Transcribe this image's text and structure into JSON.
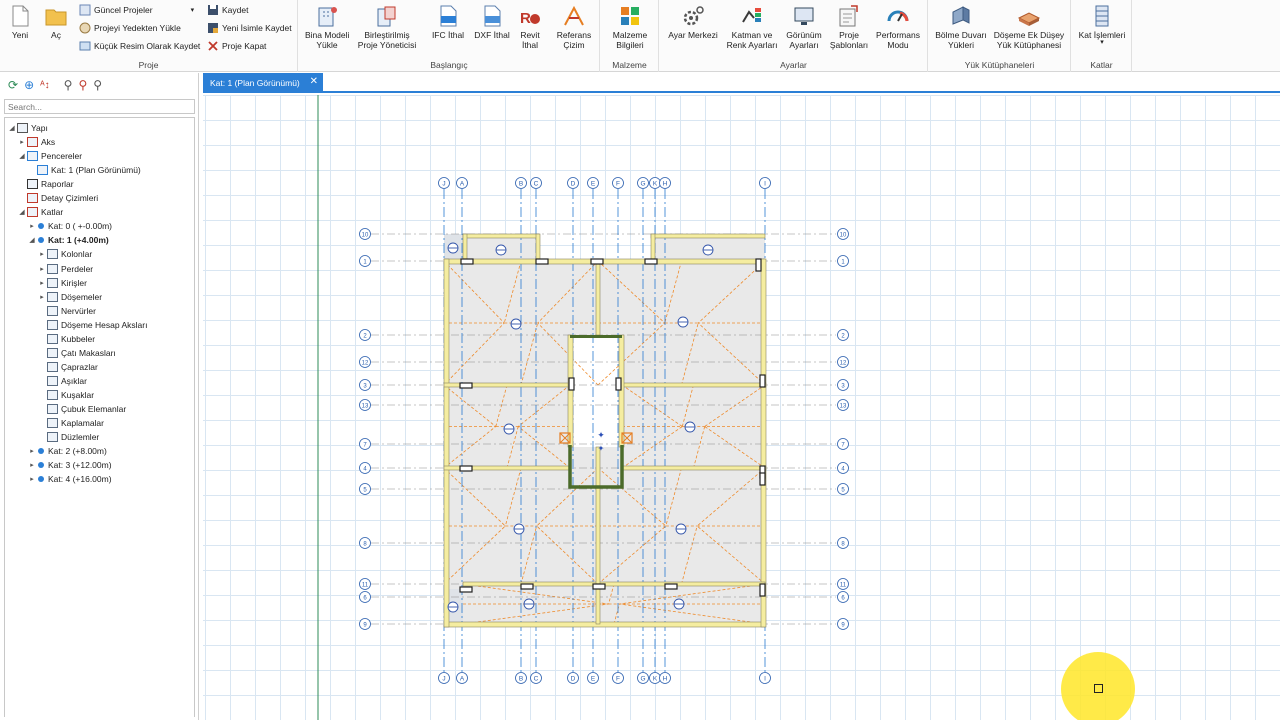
{
  "ribbon": {
    "yeni": "Yeni",
    "ac": "Aç",
    "guncel_projeler": "Güncel Projeler",
    "projeyi_yedekten_yukle": "Projeyi Yedekten Yükle",
    "kucuk_resim": "Küçük Resim Olarak Kaydet",
    "kaydet": "Kaydet",
    "yeni_isimle": "Yeni İsimle Kaydet",
    "proje_kapat": "Proje Kapat",
    "group_proje": "Proje",
    "bina_modeli": "Bina Modeli\nYükle",
    "birlestirilmis": "Birleştirilmiş\nProje Yöneticisi",
    "ifc": "IFC İthal",
    "dxf": "DXF İthal",
    "revit": "Revit\nİthal",
    "referans": "Referans\nÇizim",
    "group_baslangic": "Başlangıç",
    "malzeme_bilgileri": "Malzeme\nBilgileri",
    "group_malzeme": "Malzeme",
    "ayar_merkezi": "Ayar Merkezi",
    "katman": "Katman ve\nRenk Ayarları",
    "gorunum": "Görünüm\nAyarları",
    "proje_sablonlari": "Proje\nŞablonları",
    "performans": "Performans\nModu",
    "group_ayarlar": "Ayarlar",
    "bolme_duvari": "Bölme Duvarı\nYükleri",
    "doseme_ek": "Döşeme Ek Düşey\nYük Kütüphanesi",
    "group_yuk": "Yük Kütüphaneleri",
    "kat_islemleri": "Kat İşlemleri",
    "group_katlar": "Katlar"
  },
  "search": {
    "placeholder": "Search..."
  },
  "tree": [
    {
      "label": "Yapı",
      "level": 0,
      "arrow": "open",
      "icon": "structure-icon",
      "bold": false
    },
    {
      "label": "Aks",
      "level": 1,
      "arrow": "closed",
      "icon": "axis-icon",
      "bold": false
    },
    {
      "label": "Pencereler",
      "level": 1,
      "arrow": "open",
      "icon": "window-icon",
      "bold": false
    },
    {
      "label": "Kat: 1 (Plan Görünümü)",
      "level": 2,
      "arrow": "none",
      "icon": "plan-view-icon",
      "bold": false
    },
    {
      "label": "Raporlar",
      "level": 1,
      "arrow": "none",
      "icon": "printer-icon",
      "bold": false
    },
    {
      "label": "Detay Çizimleri",
      "level": 1,
      "arrow": "none",
      "icon": "detail-drawing-icon",
      "bold": false
    },
    {
      "label": "Katlar",
      "level": 1,
      "arrow": "open",
      "icon": "floors-icon",
      "bold": false
    },
    {
      "label": "Kat: 0 ( +-0.00m)",
      "level": 2,
      "arrow": "closed",
      "icon": "floor-dot-icon",
      "bold": false
    },
    {
      "label": "Kat: 1 (+4.00m)",
      "level": 2,
      "arrow": "open",
      "icon": "floor-dot-icon",
      "bold": true
    },
    {
      "label": "Kolonlar",
      "level": 3,
      "arrow": "closed",
      "icon": "column-icon",
      "bold": false
    },
    {
      "label": "Perdeler",
      "level": 3,
      "arrow": "closed",
      "icon": "shear-wall-icon",
      "bold": false
    },
    {
      "label": "Kirişler",
      "level": 3,
      "arrow": "closed",
      "icon": "beam-icon",
      "bold": false
    },
    {
      "label": "Döşemeler",
      "level": 3,
      "arrow": "closed",
      "icon": "slab-icon",
      "bold": false
    },
    {
      "label": "Nervürler",
      "level": 3,
      "arrow": "none",
      "icon": "rib-icon",
      "bold": false
    },
    {
      "label": "Döşeme Hesap Aksları",
      "level": 3,
      "arrow": "none",
      "icon": "slab-axis-icon",
      "bold": false
    },
    {
      "label": "Kubbeler",
      "level": 3,
      "arrow": "none",
      "icon": "dome-icon",
      "bold": false
    },
    {
      "label": "Çatı Makasları",
      "level": 3,
      "arrow": "none",
      "icon": "roof-truss-icon",
      "bold": false
    },
    {
      "label": "Çaprazlar",
      "level": 3,
      "arrow": "none",
      "icon": "brace-icon",
      "bold": false
    },
    {
      "label": "Aşıklar",
      "level": 3,
      "arrow": "none",
      "icon": "purlin-icon",
      "bold": false
    },
    {
      "label": "Kuşaklar",
      "level": 3,
      "arrow": "none",
      "icon": "girt-icon",
      "bold": false
    },
    {
      "label": "Çubuk Elemanlar",
      "level": 3,
      "arrow": "none",
      "icon": "bar-element-icon",
      "bold": false
    },
    {
      "label": "Kaplamalar",
      "level": 3,
      "arrow": "none",
      "icon": "cladding-icon",
      "bold": false
    },
    {
      "label": "Düzlemler",
      "level": 3,
      "arrow": "none",
      "icon": "plane-icon",
      "bold": false
    },
    {
      "label": "Kat: 2 (+8.00m)",
      "level": 2,
      "arrow": "closed",
      "icon": "floor-dot-icon",
      "bold": false
    },
    {
      "label": "Kat: 3 (+12.00m)",
      "level": 2,
      "arrow": "closed",
      "icon": "floor-dot-icon",
      "bold": false
    },
    {
      "label": "Kat: 4 (+16.00m)",
      "level": 2,
      "arrow": "closed",
      "icon": "floor-dot-icon",
      "bold": false
    }
  ],
  "tab": {
    "label": "Kat: 1 (Plan Görünümü)",
    "close": "✕"
  },
  "plan": {
    "vertical_axes": [
      "J",
      "A",
      "B",
      "C",
      "D",
      "E",
      "F",
      "G",
      "K",
      "H",
      "I"
    ],
    "horizontal_axes": [
      "10",
      "1",
      "2",
      "12",
      "3",
      "13",
      "7",
      "4",
      "5",
      "8",
      "11",
      "6",
      "9"
    ]
  },
  "colors": {
    "accent": "#2b7fd6",
    "beam": "#f5eda0",
    "axis": "#2a7ad0",
    "slab_line": "#ee8a2a"
  }
}
